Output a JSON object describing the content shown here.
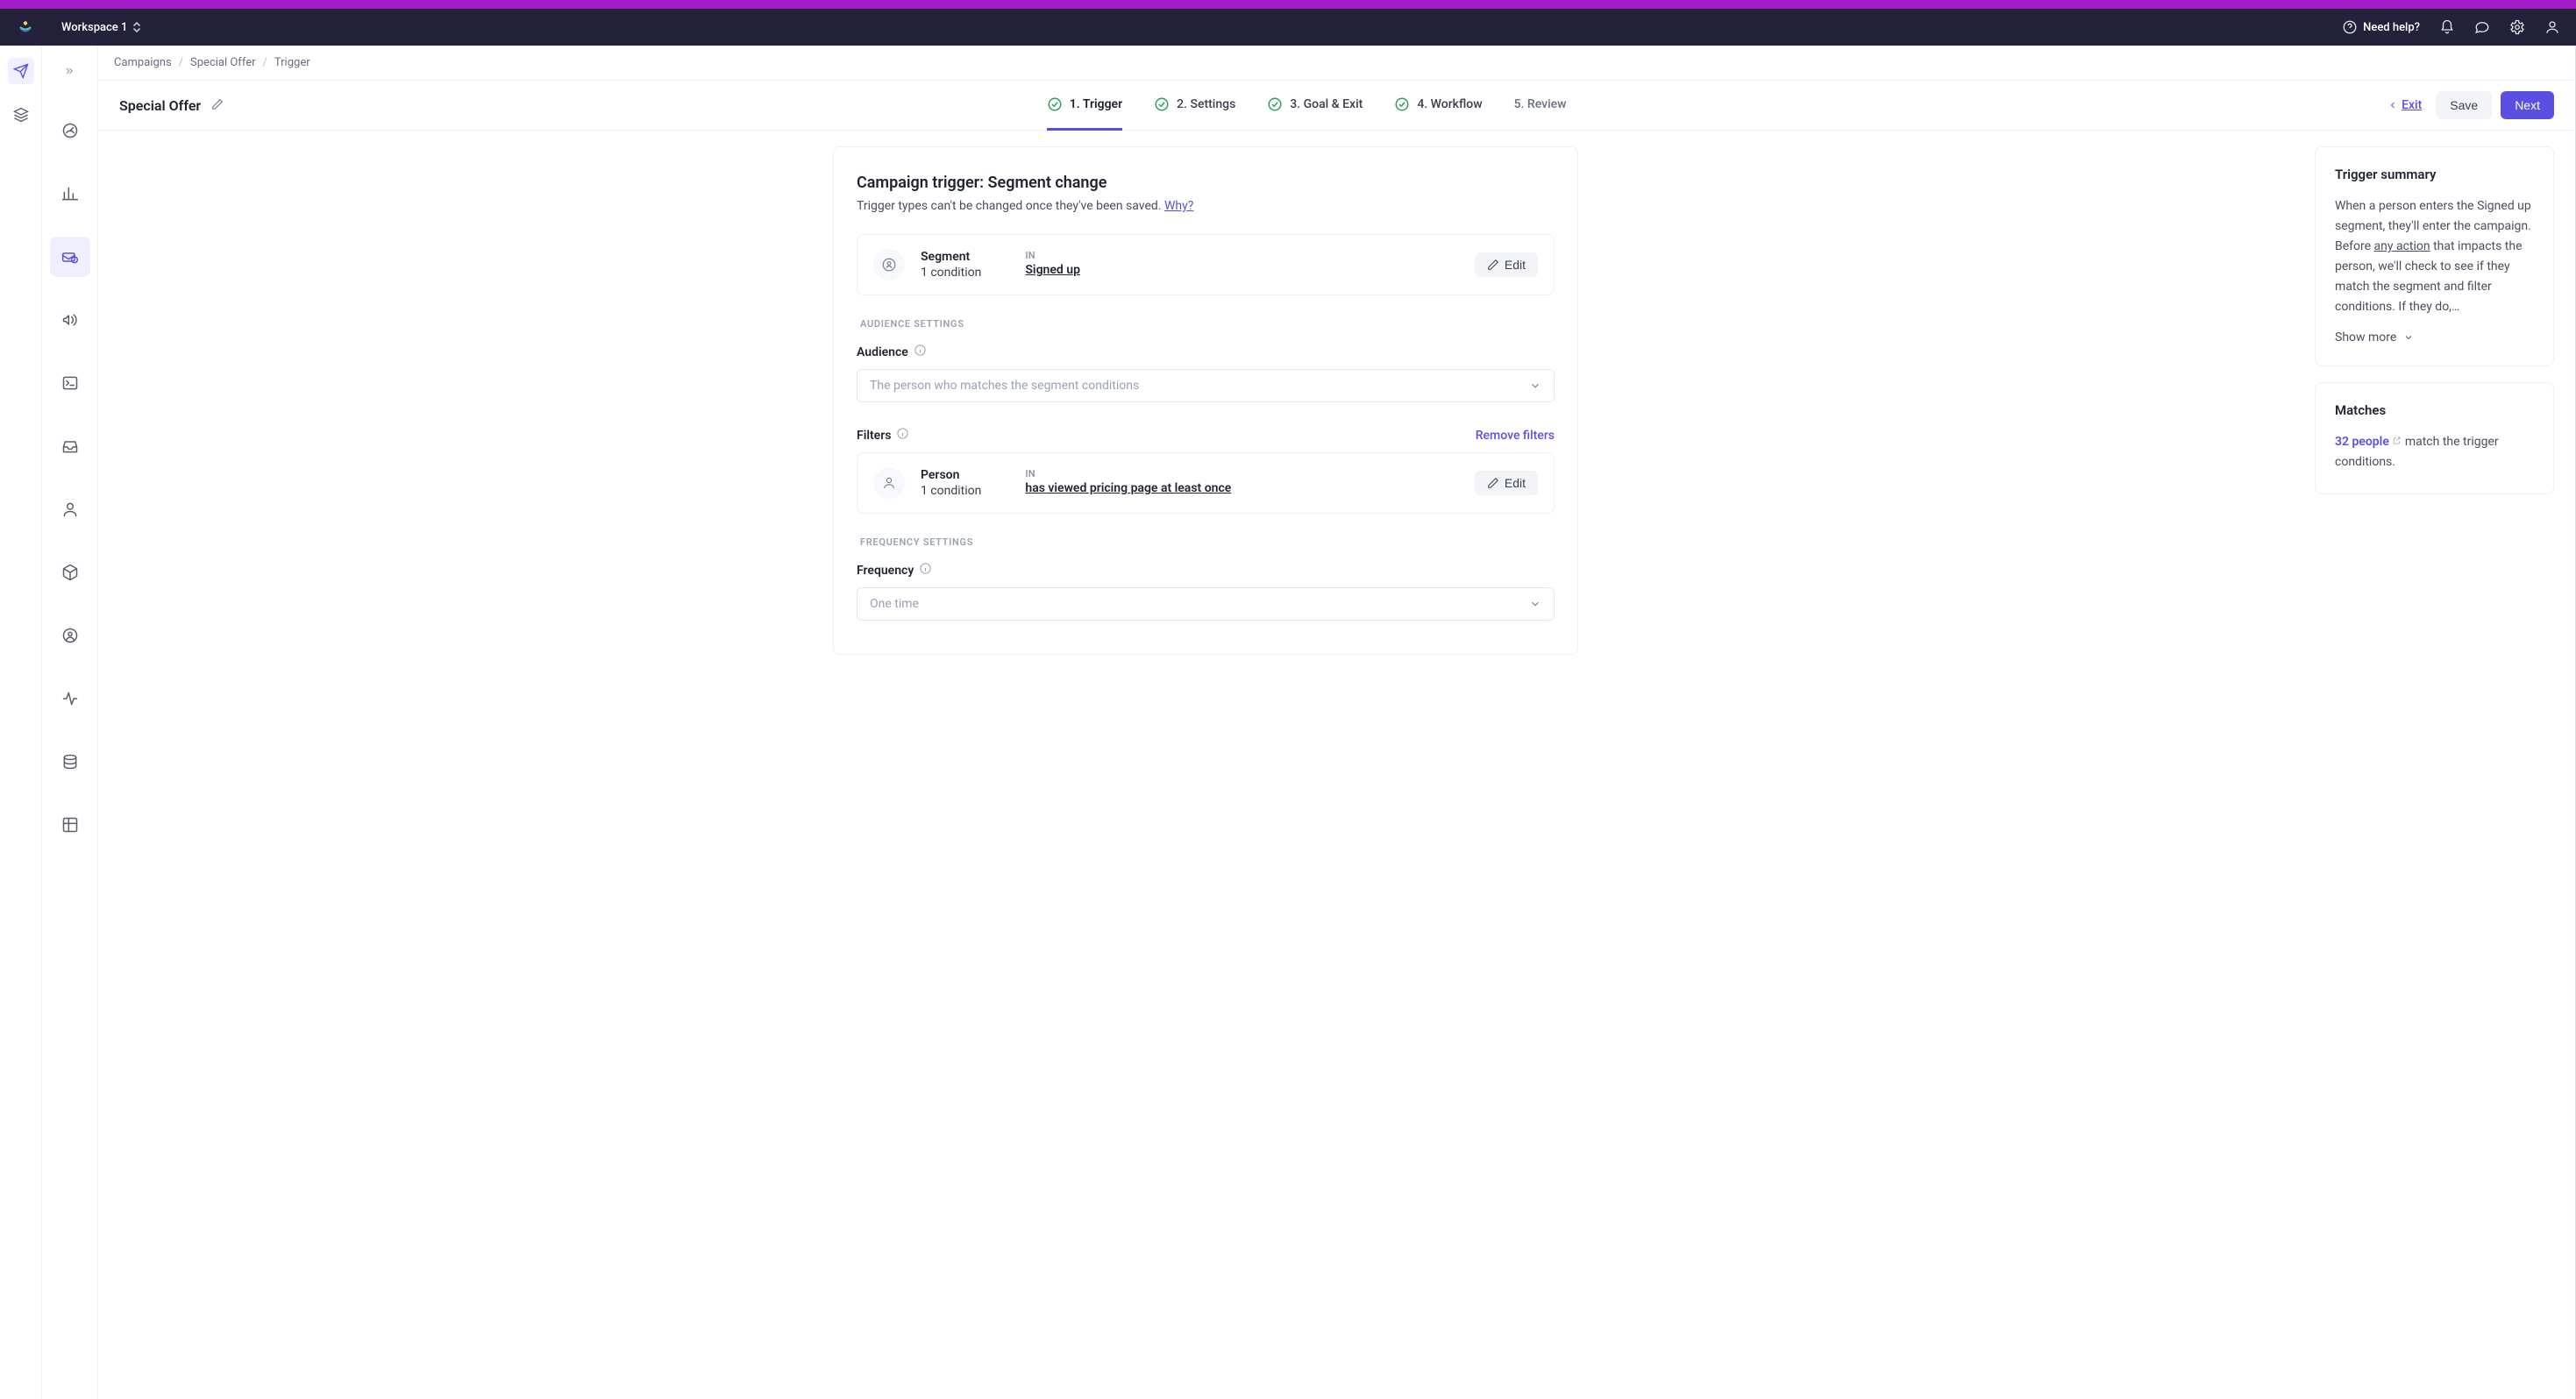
{
  "topbar": {
    "workspace": "Workspace 1",
    "need_help": "Need help?"
  },
  "breadcrumbs": {
    "campaigns": "Campaigns",
    "special_offer": "Special Offer",
    "trigger": "Trigger"
  },
  "page": {
    "title": "Special Offer",
    "exit": "Exit",
    "save": "Save",
    "next": "Next"
  },
  "steps": {
    "s1": "1. Trigger",
    "s2": "2. Settings",
    "s3": "3. Goal & Exit",
    "s4": "4. Workflow",
    "s5": "5. Review"
  },
  "card": {
    "title": "Campaign trigger: Segment change",
    "subtitle_pre": "Trigger types can't be changed once they've been saved. ",
    "subtitle_link": "Why?"
  },
  "segment": {
    "label": "Segment",
    "condition": "1 condition",
    "in": "IN",
    "value": "Signed up",
    "edit": "Edit"
  },
  "sections": {
    "audience": "AUDIENCE SETTINGS",
    "frequency": "FREQUENCY SETTINGS"
  },
  "audience": {
    "label": "Audience",
    "placeholder": "The person who matches the segment conditions"
  },
  "filters": {
    "label": "Filters",
    "remove": "Remove filters",
    "person_label": "Person",
    "person_cond": "1 condition",
    "in": "IN",
    "person_value": "has viewed pricing page at least once",
    "edit": "Edit"
  },
  "frequency": {
    "label": "Frequency",
    "placeholder": "One time"
  },
  "summary": {
    "title": "Trigger summary",
    "body_pre": "When a person enters the Signed up segment, they'll enter the campaign. Before ",
    "body_link": "any action",
    "body_post": " that impacts the person, we'll check to see if they match the segment and filter conditions. If they do,…",
    "show_more": "Show more"
  },
  "matches": {
    "title": "Matches",
    "count_text": "32 people",
    "rest": " match the trigger conditions."
  }
}
